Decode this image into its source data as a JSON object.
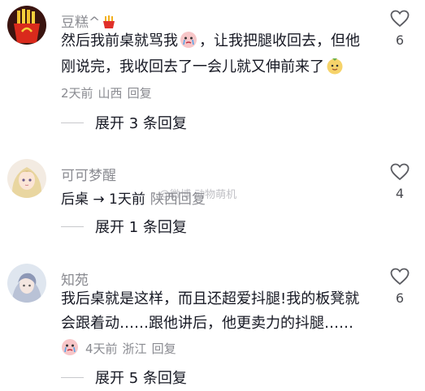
{
  "comments": [
    {
      "username": "豆糕^",
      "line1_a": "然后我前桌就骂我",
      "line1_b": "，让我把腿收回去，但他",
      "line2": "刚说完，我收回去了一会儿就又伸前来了",
      "time": "2天前",
      "location": "山西",
      "reply_label": "回复",
      "likes": "6",
      "expand_label": "展开 3 条回复"
    },
    {
      "username": "可可梦醒",
      "line1_a": "后桌 → 1天前",
      "line1_loc": "陕西",
      "line1_reply": "回复",
      "likes": "4",
      "expand_label": "展开 1 条回复"
    },
    {
      "username": "知苑",
      "line1": "我后桌就是这样，而且还超爱抖腿!我的板凳就",
      "line2": "会跟着动……跟他讲后，他更卖力的抖腿……",
      "time": "4天前",
      "location": "浙江",
      "reply_label": "回复",
      "likes": "6",
      "expand_label": "展开 5 条回复"
    }
  ],
  "watermark": "@微博 动物萌机",
  "colors": {
    "text": "#161823",
    "secondary": "#8a8b91",
    "background": "#ffffff"
  }
}
